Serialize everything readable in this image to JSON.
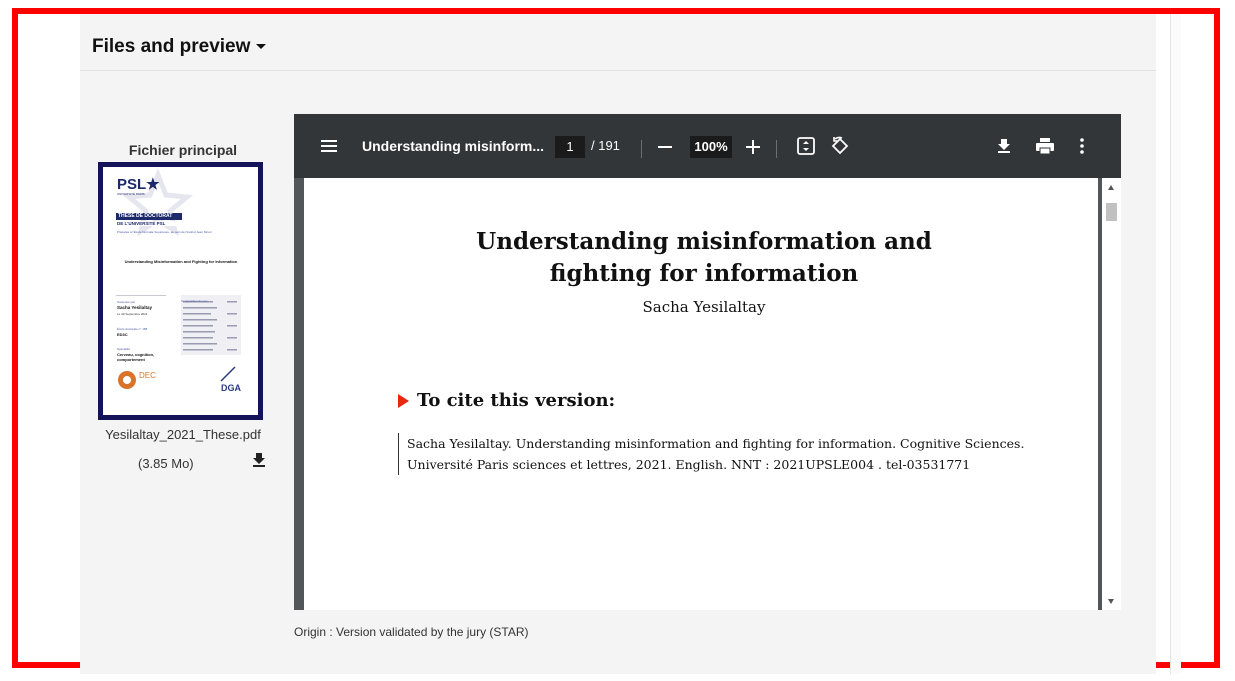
{
  "section": {
    "title": "Files and preview"
  },
  "file": {
    "label": "Fichier principal",
    "filename": "Yesilaltay_2021_These.pdf",
    "size": "(3.85 Mo)"
  },
  "thumbnail": {
    "logo": "PSL★",
    "logo_sub": "UNIVERSITÉ PARIS",
    "banner": "THÈSE DE DOCTORAT",
    "banner2": "DE L'UNIVERSITÉ PSL",
    "prep": "Préparée à l'École Normale Supérieure, au sein de l'Institut Jean Nicod",
    "title": "Understanding Misinformation and Fighting for Information",
    "soutenue_label": "Soutenue par",
    "author": "Sacha Yesilaltay",
    "date": "Le 30 Septembre 2021",
    "ecole_label": "École doctorale n° 158",
    "ecole": "ED3C",
    "spec_label": "Spécialité",
    "spec": "Cerveau, cognition, comportement",
    "jury_label": "Composition du jury :",
    "dec": "DEC",
    "dga": "DGA"
  },
  "viewer": {
    "doc_title": "Understanding misinform...",
    "page": "1",
    "total": "/ 191",
    "zoom": "100%"
  },
  "pdf": {
    "title": "Understanding misinformation and fighting for information",
    "author": "Sacha Yesilaltay",
    "cite_head": "To cite this version:",
    "cite_line1": "Sacha Yesilaltay.  Understanding misinformation and fighting for information.  Cognitive Sciences.",
    "cite_line2": "Université Paris sciences et lettres, 2021. English.  NNT : 2021UPSLE004 .  tel-03531771"
  },
  "origin": "Origin : Version validated by the jury (STAR)",
  "colors": {
    "border": "#ff0000",
    "toolbar": "#323639",
    "viewer_bg": "#525659",
    "thumb_border": "#15145a",
    "accent": "#e8270d"
  }
}
